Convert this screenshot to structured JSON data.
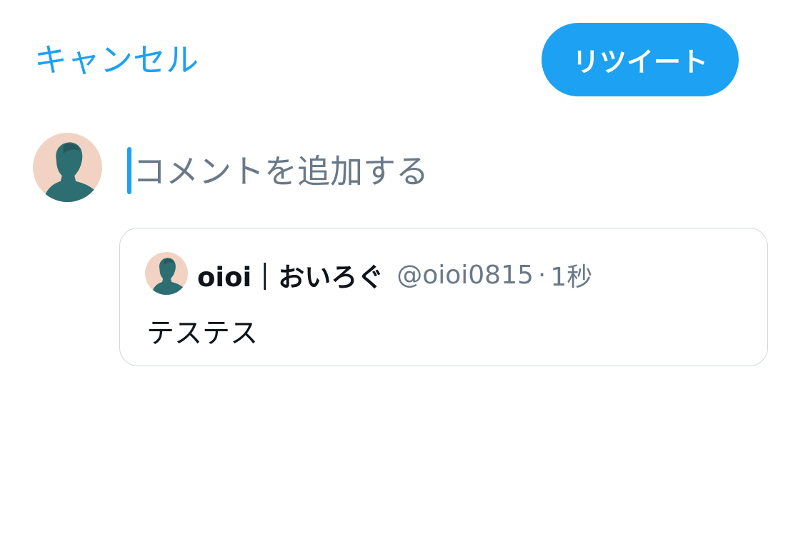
{
  "colors": {
    "accent": "#1da1f2",
    "text_primary": "#0f1419",
    "text_secondary": "#697987",
    "border": "#cfd9de"
  },
  "header": {
    "cancel_label": "キャンセル",
    "retweet_label": "リツイート"
  },
  "compose": {
    "placeholder": "コメントを追加する",
    "value": "",
    "avatar_icon": "user-avatar-icon"
  },
  "quoted_tweet": {
    "display_name": "oioi｜おいろぐ",
    "handle": "@oioi0815",
    "separator": "·",
    "timestamp": "1秒",
    "text": "テステス",
    "avatar_icon": "user-avatar-icon"
  }
}
